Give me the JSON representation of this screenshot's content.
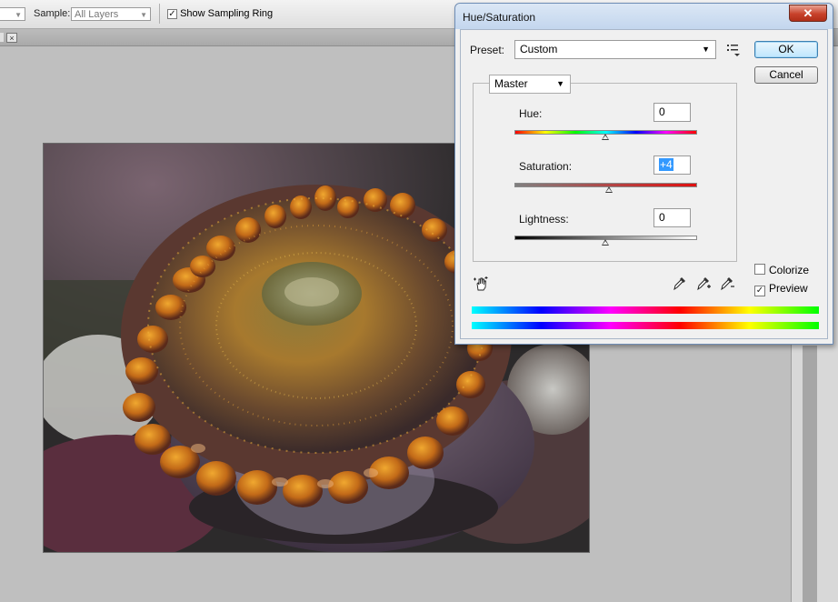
{
  "options_bar": {
    "size_value": "",
    "sample_label": "Sample:",
    "sample_value": "All Layers",
    "sampling_ring_label": "Show Sampling Ring",
    "sampling_ring_checked": true
  },
  "document_tab": {
    "close_glyph": "×"
  },
  "dialog": {
    "title": "Hue/Saturation",
    "close_glyph": "✕",
    "preset_label": "Preset:",
    "preset_value": "Custom",
    "ok_label": "OK",
    "cancel_label": "Cancel",
    "channel_value": "Master",
    "hue": {
      "label": "Hue:",
      "value": "0"
    },
    "saturation": {
      "label": "Saturation:",
      "value": "+4"
    },
    "lightness": {
      "label": "Lightness:",
      "value": "0"
    },
    "colorize": {
      "label": "Colorize",
      "checked": false
    },
    "preview": {
      "label": "Preview",
      "checked": true
    },
    "icons": [
      "preset-options-icon",
      "targeted-adjustment-hand-icon",
      "eyedropper-icon",
      "eyedropper-plus-icon",
      "eyedropper-minus-icon"
    ]
  },
  "colors": {
    "dialog_bg": "#f0f0f0",
    "default_button": "#bee6fd",
    "close_button": "#c8412b",
    "workspace": "#c0c0c0"
  }
}
